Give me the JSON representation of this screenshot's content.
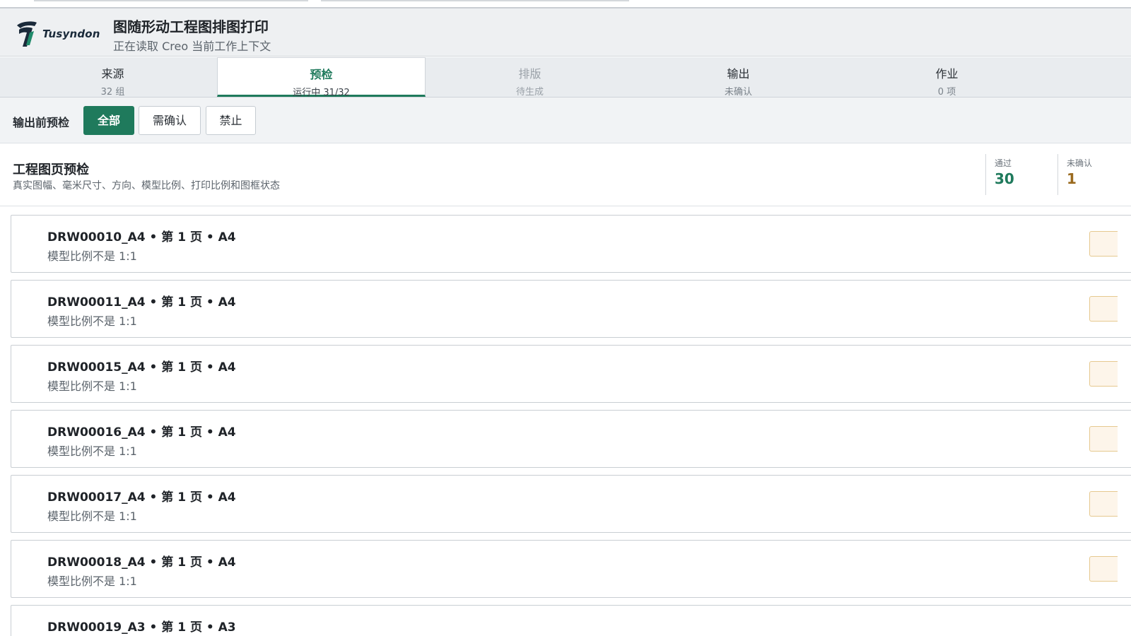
{
  "app": {
    "brand": "Tusyndon",
    "title": "图随形动工程图排图打印",
    "subtitle": "正在读取 Creo 当前工作上下文"
  },
  "tabs": [
    {
      "label": "来源",
      "sub": "32 组",
      "state": "normal"
    },
    {
      "label": "预检",
      "sub": "运行中 31/32",
      "state": "active"
    },
    {
      "label": "排版",
      "sub": "待生成",
      "state": "disabled"
    },
    {
      "label": "输出",
      "sub": "未确认",
      "state": "normal"
    },
    {
      "label": "作业",
      "sub": "0 项",
      "state": "normal"
    }
  ],
  "filter": {
    "label": "输出前预检",
    "options": [
      "全部",
      "需确认",
      "禁止"
    ],
    "selected": "全部"
  },
  "section": {
    "title": "工程图页预检",
    "description": "真实图幅、毫米尺寸、方向、模型比例、打印比例和图框状态"
  },
  "stats": [
    {
      "label": "通过",
      "value": "30",
      "color": "#1f7a5c"
    },
    {
      "label": "未确认",
      "value": "1",
      "color": "#9a6a1e"
    }
  ],
  "colors": {
    "accent": "#1f7a5c",
    "warning": "#9a6a1e",
    "warning_bg": "#fdf5ea"
  },
  "items": [
    {
      "title": "DRW00010_A4 • 第 1 页 • A4",
      "detail": "模型比例不是 1:1"
    },
    {
      "title": "DRW00011_A4 • 第 1 页 • A4",
      "detail": "模型比例不是 1:1"
    },
    {
      "title": "DRW00015_A4 • 第 1 页 • A4",
      "detail": "模型比例不是 1:1"
    },
    {
      "title": "DRW00016_A4 • 第 1 页 • A4",
      "detail": "模型比例不是 1:1"
    },
    {
      "title": "DRW00017_A4 • 第 1 页 • A4",
      "detail": "模型比例不是 1:1"
    },
    {
      "title": "DRW00018_A4 • 第 1 页 • A4",
      "detail": "模型比例不是 1:1"
    },
    {
      "title": "DRW00019_A3 • 第 1 页 • A3",
      "detail": ""
    }
  ]
}
